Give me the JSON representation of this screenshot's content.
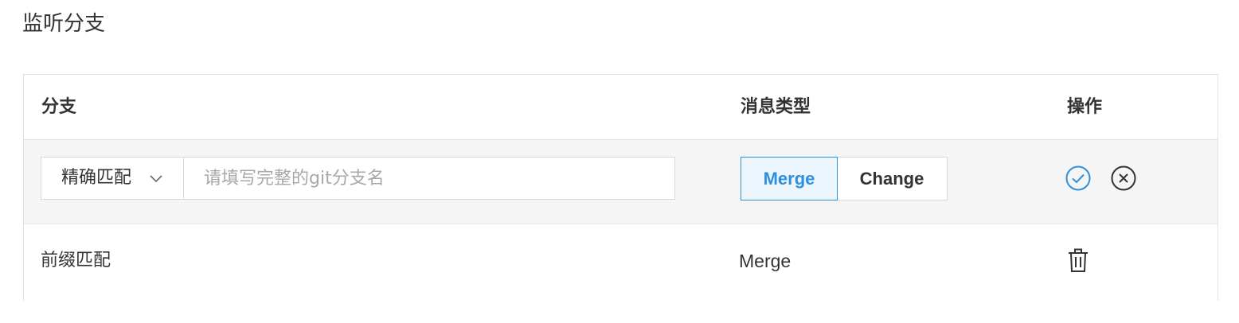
{
  "section": {
    "title": "监听分支"
  },
  "table": {
    "headers": {
      "branch": "分支",
      "message_type": "消息类型",
      "action": "操作"
    },
    "edit_row": {
      "match_select": {
        "value": "精确匹配",
        "icon": "chevron-down-icon"
      },
      "branch_input": {
        "value": "",
        "placeholder": "请填写完整的git分支名"
      },
      "type_options": [
        "Merge",
        "Change"
      ],
      "selected_type": "Merge",
      "actions": {
        "confirm_icon": "check-circle-icon",
        "cancel_icon": "close-circle-icon"
      }
    },
    "rows": [
      {
        "match": "前缀匹配",
        "message_type": "Merge",
        "action_icon": "trash-icon"
      }
    ]
  },
  "colors": {
    "accent": "#2d8fe0",
    "text": "#333333",
    "placeholder": "#a8a8a8",
    "border": "#d9d9d9",
    "edit_row_bg": "#f5f5f5"
  }
}
